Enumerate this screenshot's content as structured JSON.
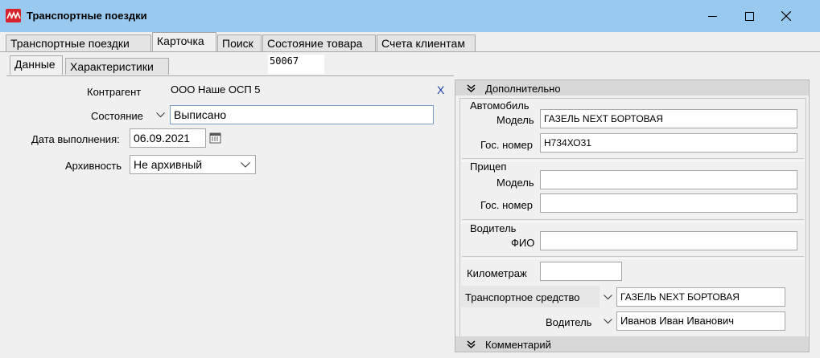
{
  "window": {
    "title": "Транспортные поездки",
    "brand_color": "#d9232a"
  },
  "tabs": [
    "Транспортные поездки",
    "Карточка",
    "Поиск",
    "Состояние товара",
    "Счета клиентам"
  ],
  "subtabs": [
    "Данные",
    "Характеристики"
  ],
  "record_id": "50067",
  "left": {
    "counterparty_label": "Контрагент",
    "counterparty_value": "ООО Наше ОСП 5",
    "clear_label": "X",
    "state_label": "Состояние",
    "state_value": "Выписано",
    "date_label": "Дата выполнения:",
    "date_value": "06.09.2021",
    "archive_label": "Архивность",
    "archive_value": "Не архивный"
  },
  "right": {
    "additional_header": "Дополнительно",
    "car": {
      "group": "Автомобиль",
      "model_label": "Модель",
      "model_value": "ГАЗЕЛЬ NEXT БОРТОВАЯ",
      "plate_label": "Гос. номер",
      "plate_value": "Н734ХО31"
    },
    "trailer": {
      "group": "Прицеп",
      "model_label": "Модель",
      "model_value": "",
      "plate_label": "Гос. номер",
      "plate_value": ""
    },
    "driver": {
      "group": "Водитель",
      "fio_label": "ФИО",
      "fio_value": ""
    },
    "mileage_label": "Километраж",
    "mileage_value": "",
    "vehicle_label": "Транспортное средство",
    "vehicle_value": "ГАЗЕЛЬ NEXT БОРТОВАЯ",
    "driver_label": "Водитель",
    "driver_value": "Иванов Иван Иванович",
    "comment_header": "Комментарий"
  }
}
